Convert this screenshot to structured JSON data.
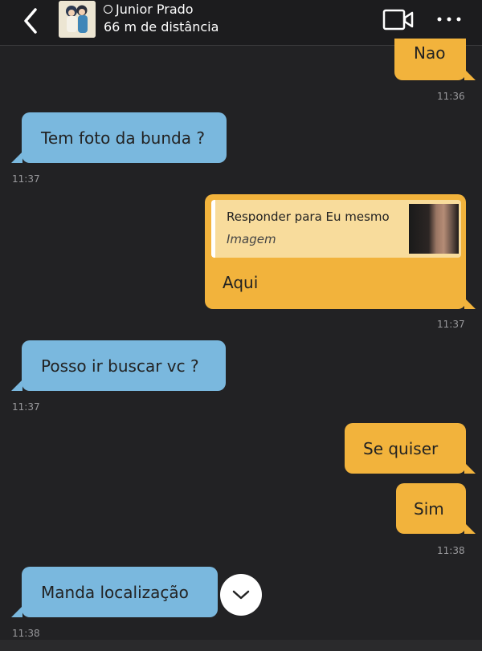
{
  "header": {
    "contact_name": "Junior Prado",
    "distance": "66 m de distância",
    "back_icon": "chevron-left-icon",
    "video_icon": "video-camera-icon",
    "more_icon": "more-horizontal-icon"
  },
  "colors": {
    "incoming_bubble": "#7ab8de",
    "outgoing_bubble": "#f2b33c",
    "background": "#222224"
  },
  "messages": [
    {
      "direction": "out",
      "text": "Nao",
      "time": "11:36"
    },
    {
      "direction": "in",
      "text": "Tem foto da bunda ?",
      "time": "11:37"
    },
    {
      "direction": "out",
      "text": "Aqui",
      "time": "11:37",
      "reply": {
        "title": "Responder para Eu mesmo",
        "subtitle": "Imagem"
      }
    },
    {
      "direction": "in",
      "text": "Posso ir buscar vc ?",
      "time": "11:37"
    },
    {
      "direction": "out",
      "text": "Se quiser"
    },
    {
      "direction": "out",
      "text": "Sim",
      "time": "11:38"
    },
    {
      "direction": "in",
      "text": "Manda localização",
      "time": "11:38"
    }
  ]
}
